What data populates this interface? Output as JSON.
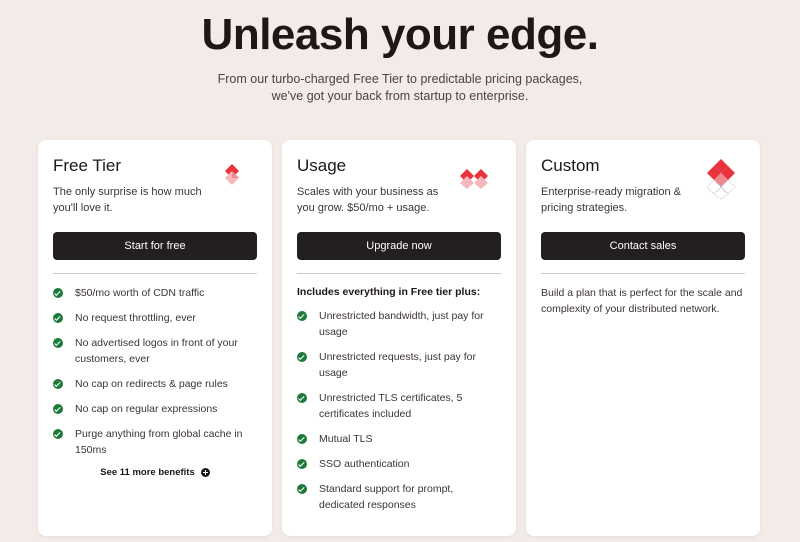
{
  "hero": {
    "title": "Unleash your edge.",
    "subtitle_line1": "From our turbo-charged Free Tier to predictable pricing packages,",
    "subtitle_line2": "we've got your back from startup to enterprise."
  },
  "colors": {
    "background": "#f2ebe8",
    "button": "#231f1e",
    "check": "#1d7a3a",
    "accent_red": "#e8323c"
  },
  "plans": {
    "free": {
      "title": "Free Tier",
      "description": "The only surprise is how much you'll love it.",
      "icon": "single-diamond-icon",
      "cta": "Start for free",
      "features": [
        "$50/mo worth of CDN traffic",
        "No request throttling, ever",
        "No advertised logos in front of your customers, ever",
        "No cap on redirects & page rules",
        "No cap on regular expressions",
        "Purge anything from global cache in 150ms"
      ],
      "more_link": "See 11 more benefits"
    },
    "usage": {
      "title": "Usage",
      "description": "Scales with your business as you grow. $50/mo + usage.",
      "icon": "double-diamond-icon",
      "cta": "Upgrade now",
      "includes": "Includes everything in Free tier plus:",
      "features": [
        "Unrestricted bandwidth, just pay for usage",
        "Unrestricted requests, just pay for usage",
        "Unrestricted TLS certificates, 5 certificates included",
        "Mutual TLS",
        "SSO authentication",
        "Standard support for prompt, dedicated responses"
      ]
    },
    "custom": {
      "title": "Custom",
      "description": "Enterprise-ready migration & pricing strategies.",
      "icon": "diamond-cluster-icon",
      "cta": "Contact sales",
      "text": "Build a plan that is perfect for the scale and complexity of your distributed network."
    }
  }
}
